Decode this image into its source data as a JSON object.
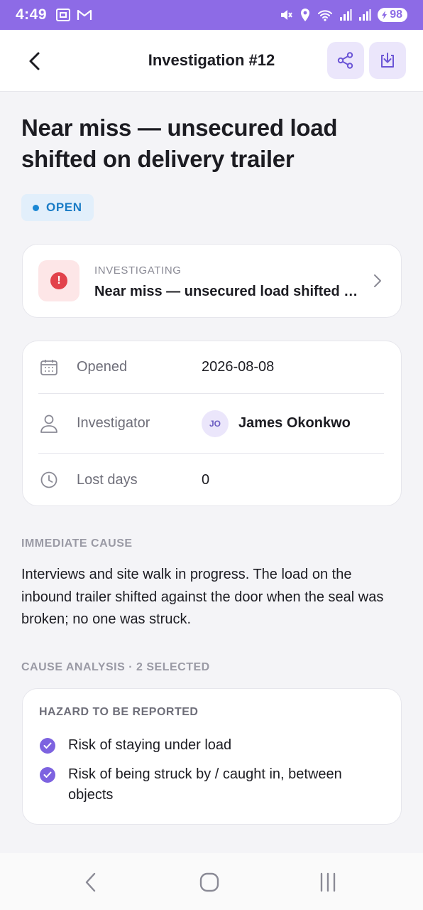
{
  "status_bar": {
    "time": "4:49",
    "battery": "98",
    "accent_color": "#8d6be6"
  },
  "header": {
    "title": "Investigation #12",
    "back_icon": "chevron-left-icon",
    "share_icon": "share-icon",
    "download_icon": "download-icon"
  },
  "page": {
    "title": "Near miss — unsecured load shifted on delivery trailer",
    "status": "OPEN",
    "status_color": "#1a87d4"
  },
  "incident": {
    "kicker": "INVESTIGATING",
    "title": "Near miss — unsecured load shifted on delivery trailer",
    "icon": "alert-icon",
    "icon_color": "#e2424b"
  },
  "details": {
    "opened": {
      "label": "Opened",
      "value": "2026-08-08",
      "icon": "calendar-icon"
    },
    "investigator": {
      "label": "Investigator",
      "initials": "JO",
      "name": "James Okonkwo",
      "icon": "person-icon"
    },
    "lost_days": {
      "label": "Lost days",
      "value": "0",
      "icon": "clock-icon"
    }
  },
  "immediate_cause": {
    "label": "IMMEDIATE CAUSE",
    "text": "Interviews and site walk in progress. The load on the inbound trailer shifted against the door when the seal was broken; no one was struck."
  },
  "cause_analysis": {
    "label": "CAUSE ANALYSIS · 2 SELECTED",
    "group_heading": "HAZARD TO BE REPORTED",
    "items": [
      "Risk of staying under load",
      "Risk of being struck by / caught in, between objects"
    ],
    "check_color": "#7d63e0"
  },
  "nav": {
    "back_icon": "nav-back-icon",
    "home_icon": "nav-home-icon",
    "recents_icon": "nav-recents-icon"
  }
}
